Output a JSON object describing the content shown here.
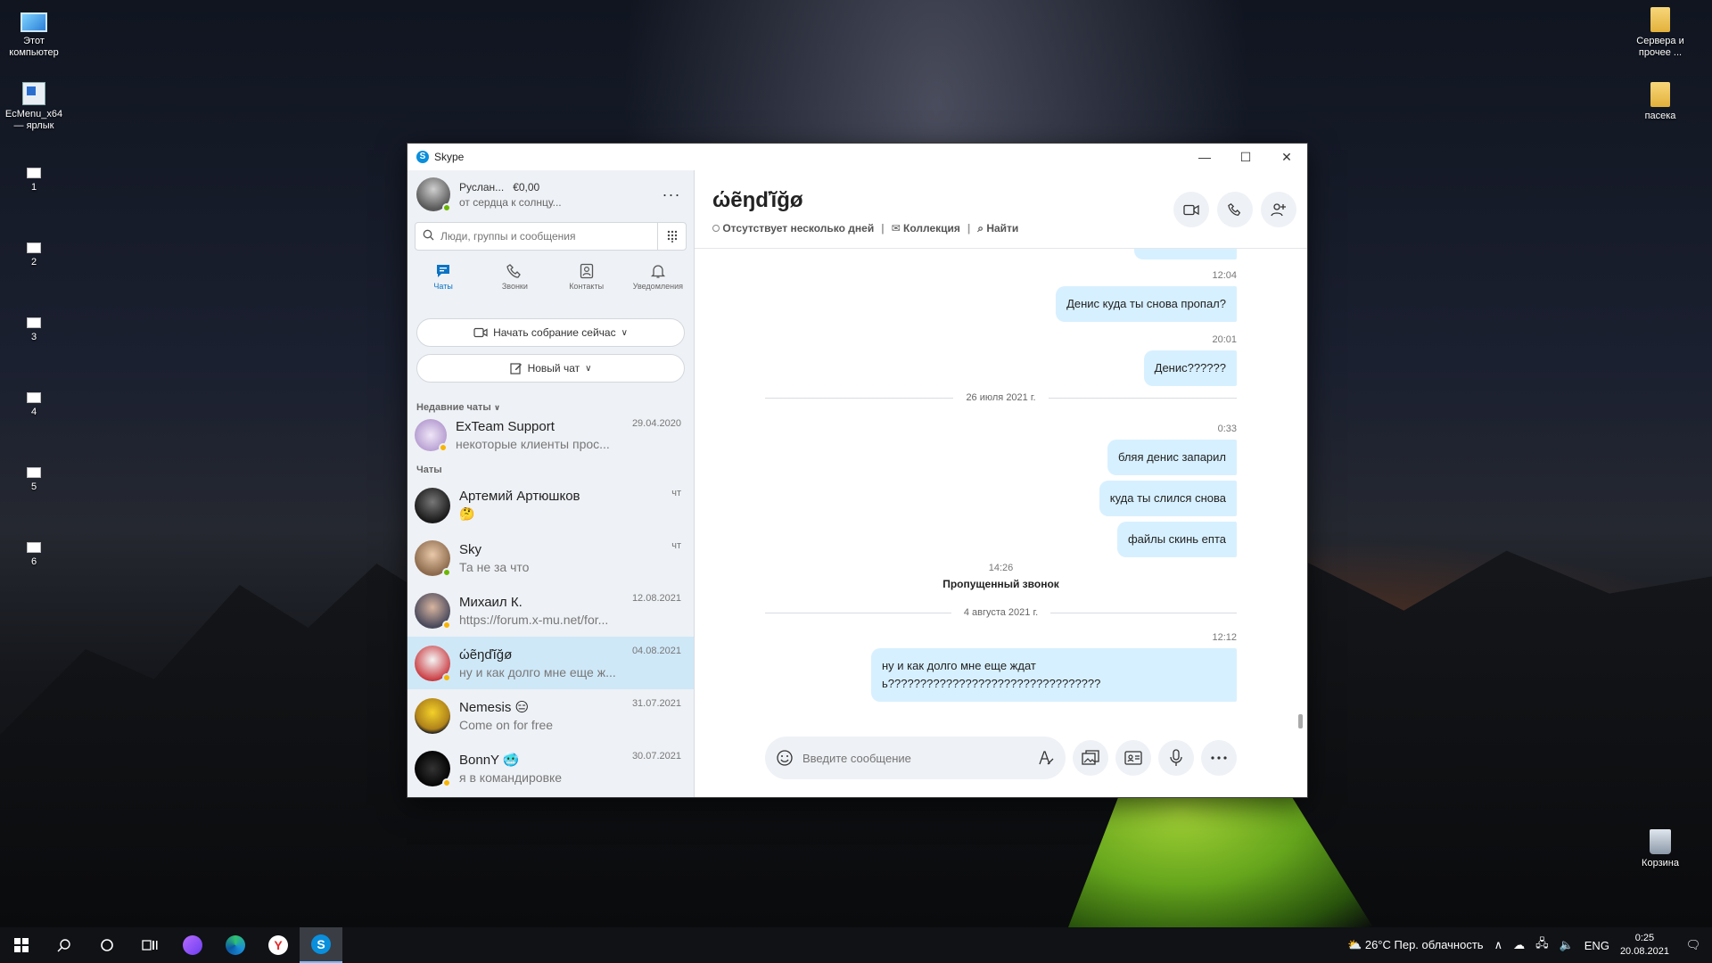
{
  "desktop": {
    "icons_left": [
      {
        "label": "Этот компьютер",
        "icon": "computer-icon"
      },
      {
        "label": "EcMenu_x64 — ярлык",
        "icon": "shortcut-icon"
      },
      {
        "label": "1",
        "icon": "file-icon"
      },
      {
        "label": "2",
        "icon": "file-icon"
      },
      {
        "label": "3",
        "icon": "file-icon"
      },
      {
        "label": "4",
        "icon": "file-icon"
      },
      {
        "label": "5",
        "icon": "file-icon"
      },
      {
        "label": "6",
        "icon": "file-icon"
      }
    ],
    "icons_right": [
      {
        "label": "Сервера и прочее ...",
        "icon": "folder-icon"
      },
      {
        "label": "пасека",
        "icon": "folder-icon"
      },
      {
        "label": "Корзина",
        "icon": "recycle-bin-icon"
      }
    ]
  },
  "window": {
    "title": "Skype",
    "controls": {
      "minimize": "—",
      "maximize": "☐",
      "close": "✕"
    }
  },
  "profile": {
    "name": "Руслан...",
    "balance": "€0,00",
    "mood": "от сердца к солнцу...",
    "more": "···"
  },
  "search": {
    "placeholder": "Люди, группы и сообщения"
  },
  "nav": [
    {
      "label": "Чаты",
      "icon": "chat-icon",
      "active": true
    },
    {
      "label": "Звонки",
      "icon": "phone-icon"
    },
    {
      "label": "Контакты",
      "icon": "contacts-icon"
    },
    {
      "label": "Уведомления",
      "icon": "bell-icon"
    }
  ],
  "actions": {
    "meet_now": "Начать собрание сейчас",
    "new_chat": "Новый чат"
  },
  "recent_label": "Недавние чаты",
  "chats_label": "Чаты",
  "recent_chat": {
    "name": "ExTeam Support",
    "preview": "некоторые клиенты прос...",
    "date": "29.04.2020"
  },
  "chats": [
    {
      "name": "Артемий Артюшков",
      "preview": "🤔",
      "date": "чт",
      "status": "none"
    },
    {
      "name": "Sky",
      "preview": "Та не за что",
      "date": "чт",
      "status": "online"
    },
    {
      "name": "Михаил К.",
      "preview": "https://forum.x-mu.net/for...",
      "date": "12.08.2021",
      "status": "away"
    },
    {
      "name": "ώẽŋďĭğø",
      "preview": "ну и как долго мне еще ж...",
      "date": "04.08.2021",
      "status": "away",
      "active": true
    },
    {
      "name": "Nemesis 😑",
      "preview": "Come on for free",
      "date": "31.07.2021",
      "status": "none"
    },
    {
      "name": "BonnY 🥶",
      "preview": "я в командировке",
      "date": "30.07.2021",
      "status": "away"
    }
  ],
  "conversation": {
    "name": "ώẽŋďĭğø",
    "status": "Отсутствует несколько дней",
    "gallery": "Коллекция",
    "find": "Найти",
    "messages_block1": [
      {
        "time": "12:04",
        "text": "Денис куда ты снова пропал?"
      },
      {
        "time": "20:01",
        "text": "Денис??????"
      }
    ],
    "date_divider_1": "26 июля 2021 г.",
    "time_block2": "0:33",
    "messages_block2": [
      "бляя денис запарил",
      "куда ты слился снова",
      "файлы скинь епта"
    ],
    "missed_time": "14:26",
    "missed_label": "Пропущенный звонок",
    "date_divider_2": "4 августа 2021 г.",
    "time_block3": "12:12",
    "message_block3": "ну и как долго мне еще ждать?????????????????????????????????"
  },
  "composer": {
    "placeholder": "Введите сообщение"
  },
  "taskbar": {
    "weather": "26°C  Пер. облачность",
    "language": "ENG",
    "time": "0:25",
    "date": "20.08.2021"
  },
  "colors": {
    "accent": "#0a73c5",
    "bubble": "#d7f0ff",
    "online": "#6bb700",
    "away": "#f8b400"
  }
}
